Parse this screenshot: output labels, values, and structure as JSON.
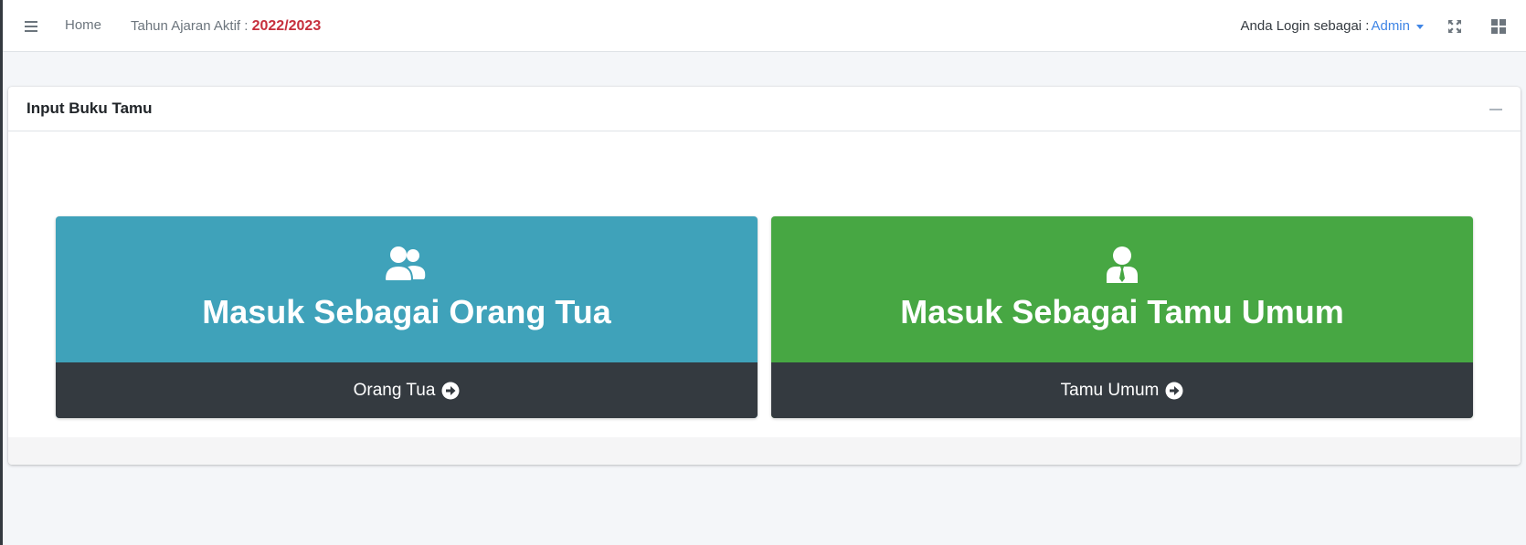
{
  "navbar": {
    "home_label": "Home",
    "year_prefix": "Tahun Ajaran Aktif : ",
    "year_value": "2022/2023",
    "login_prefix": "Anda Login sebagai :",
    "login_user": "Admin",
    "icons": [
      "menu-icon",
      "expand-icon",
      "grid-icon"
    ]
  },
  "card": {
    "title": "Input Buku Tamu"
  },
  "boxes": [
    {
      "title": "Masuk Sebagai Orang Tua",
      "link_label": "Orang Tua",
      "icon": "users-icon",
      "color": "#3fa2ba"
    },
    {
      "title": "Masuk Sebagai Tamu Umum",
      "link_label": "Tamu Umum",
      "icon": "user-tie-icon",
      "color": "#47a743"
    }
  ],
  "colors": {
    "accent": "#3f85e5",
    "year": "#c62f3d",
    "footer_dark": "#343a40"
  }
}
